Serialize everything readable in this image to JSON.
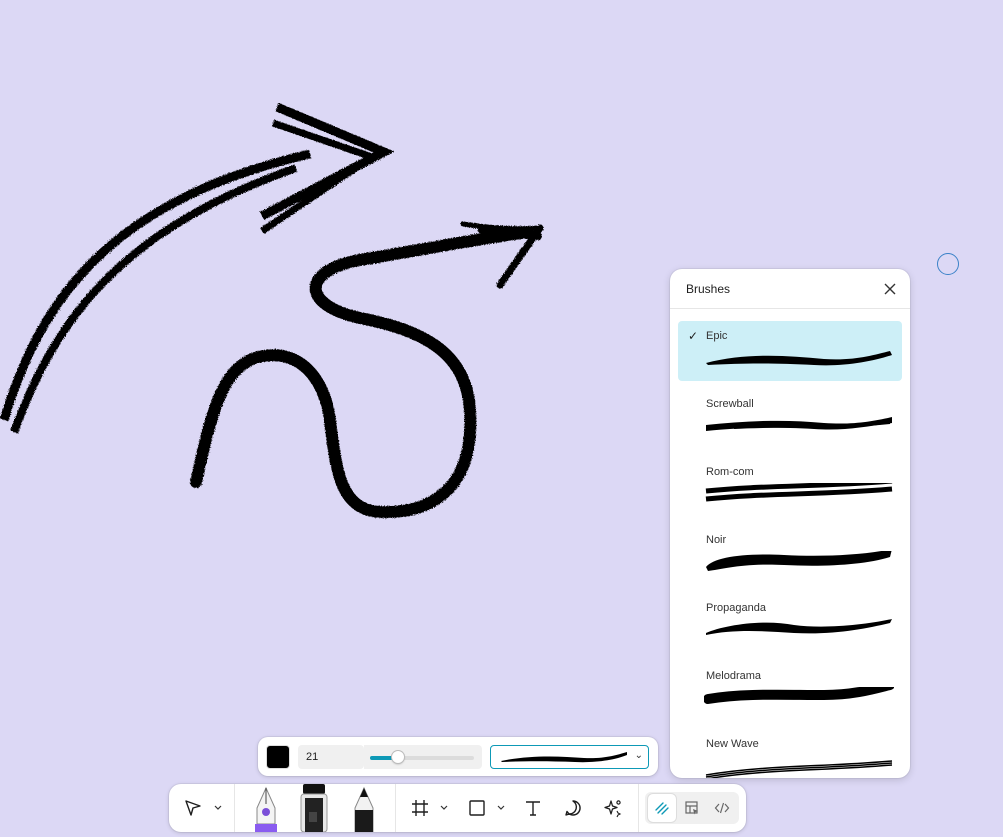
{
  "canvas": {
    "background": "#dcd8f5",
    "stroke_color": "#000000"
  },
  "brushes_panel": {
    "title": "Brushes",
    "close_icon": "close-icon",
    "selected_check": "✓",
    "items": [
      {
        "name": "Epic",
        "selected": true
      },
      {
        "name": "Screwball",
        "selected": false
      },
      {
        "name": "Rom-com",
        "selected": false
      },
      {
        "name": "Noir",
        "selected": false
      },
      {
        "name": "Propaganda",
        "selected": false
      },
      {
        "name": "Melodrama",
        "selected": false
      },
      {
        "name": "New Wave",
        "selected": false
      }
    ],
    "selected_color": "#cdeff7"
  },
  "brush_options": {
    "color": "#000000",
    "size": "21",
    "size_fraction": 0.27,
    "accent": "#0d99b6",
    "selected_brush": "Epic",
    "chevron": "⌄"
  },
  "toolbar": {
    "tools": [
      {
        "icon": "move-pointer-icon"
      },
      {
        "icon": "pen-tool-icon"
      },
      {
        "icon": "marker-tool-icon"
      },
      {
        "icon": "pencil-tool-icon"
      },
      {
        "icon": "frame-icon"
      },
      {
        "icon": "rectangle-icon"
      },
      {
        "icon": "text-icon"
      },
      {
        "icon": "comment-icon"
      },
      {
        "icon": "ai-actions-icon"
      }
    ],
    "modes": [
      {
        "icon": "draw-mode-icon",
        "active": true
      },
      {
        "icon": "design-mode-icon",
        "active": false
      },
      {
        "icon": "dev-mode-icon",
        "active": false
      }
    ]
  }
}
